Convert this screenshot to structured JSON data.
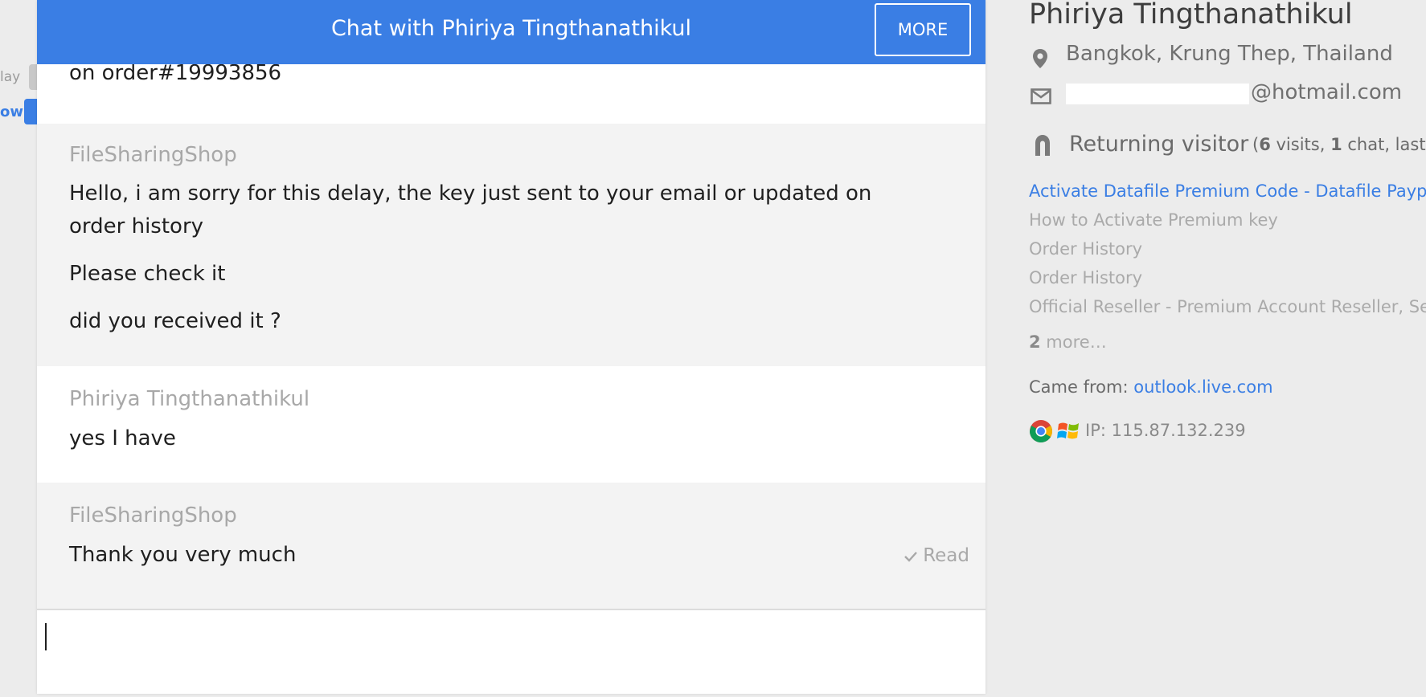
{
  "left_stub": {
    "item_1_text": "lay",
    "item_2_text": "ow"
  },
  "chat": {
    "title": "Chat with Phiriya Tingthanathikul",
    "more_button": "MORE",
    "header_color": "#3a7ee4",
    "messages": [
      {
        "author": "",
        "lines": [
          "on order#19993856"
        ]
      },
      {
        "author": "FileSharingShop",
        "lines": [
          "Hello, i am sorry for this delay, the key just sent to your email or updated on",
          "order history",
          "Please check it",
          "did you received it ?"
        ]
      },
      {
        "author": "Phiriya Tingthanathikul",
        "lines": [
          "yes I have"
        ]
      },
      {
        "author": "FileSharingShop",
        "lines": [
          "Thank you very much"
        ],
        "status": "Read"
      }
    ],
    "composer_value": ""
  },
  "visitor": {
    "name": "Phiriya Tingthanathikul",
    "location": "Bangkok, Krung Thep, Thailand",
    "email_visible": "@hotmail.com",
    "returning_label": "Returning visitor",
    "visits_open": "(",
    "visits_count": "6",
    "visits_word": " visits, ",
    "chats_count": "1",
    "chats_word": " chat, last se",
    "pages": [
      {
        "title": "Activate Datafile Premium Code - Datafile Paypal",
        "state": "active"
      },
      {
        "title": "How to Activate Premium key",
        "state": "visited"
      },
      {
        "title": "Order History",
        "state": "visited"
      },
      {
        "title": "Order History",
        "state": "visited"
      },
      {
        "title": "Official Reseller - Premium Account Reseller, Secure",
        "state": "visited"
      }
    ],
    "more_count": "2",
    "more_word": " more…",
    "came_from_label": "Came from: ",
    "came_from_link": "outlook.live.com",
    "ip": "IP: 115.87.132.239",
    "icons": [
      "location-pin-icon",
      "envelope-icon",
      "returning-visitor-icon",
      "chrome-icon",
      "windows-icon"
    ]
  }
}
